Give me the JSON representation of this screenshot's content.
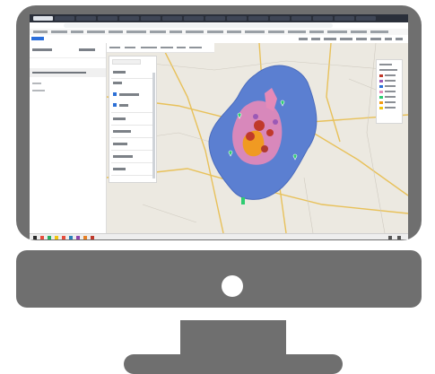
{
  "colors": {
    "monitor_body": "#6f6f6f",
    "coverage_blue": "#5b7fd1",
    "cluster_pink": "#e58ab8",
    "cluster_red": "#c0392b",
    "cluster_orange": "#f39c12",
    "map_base": "#ece9e1",
    "accent_blue": "#2b6fd6"
  },
  "icons": {
    "power": "power-button-icon",
    "markers": "map-marker-icon"
  }
}
